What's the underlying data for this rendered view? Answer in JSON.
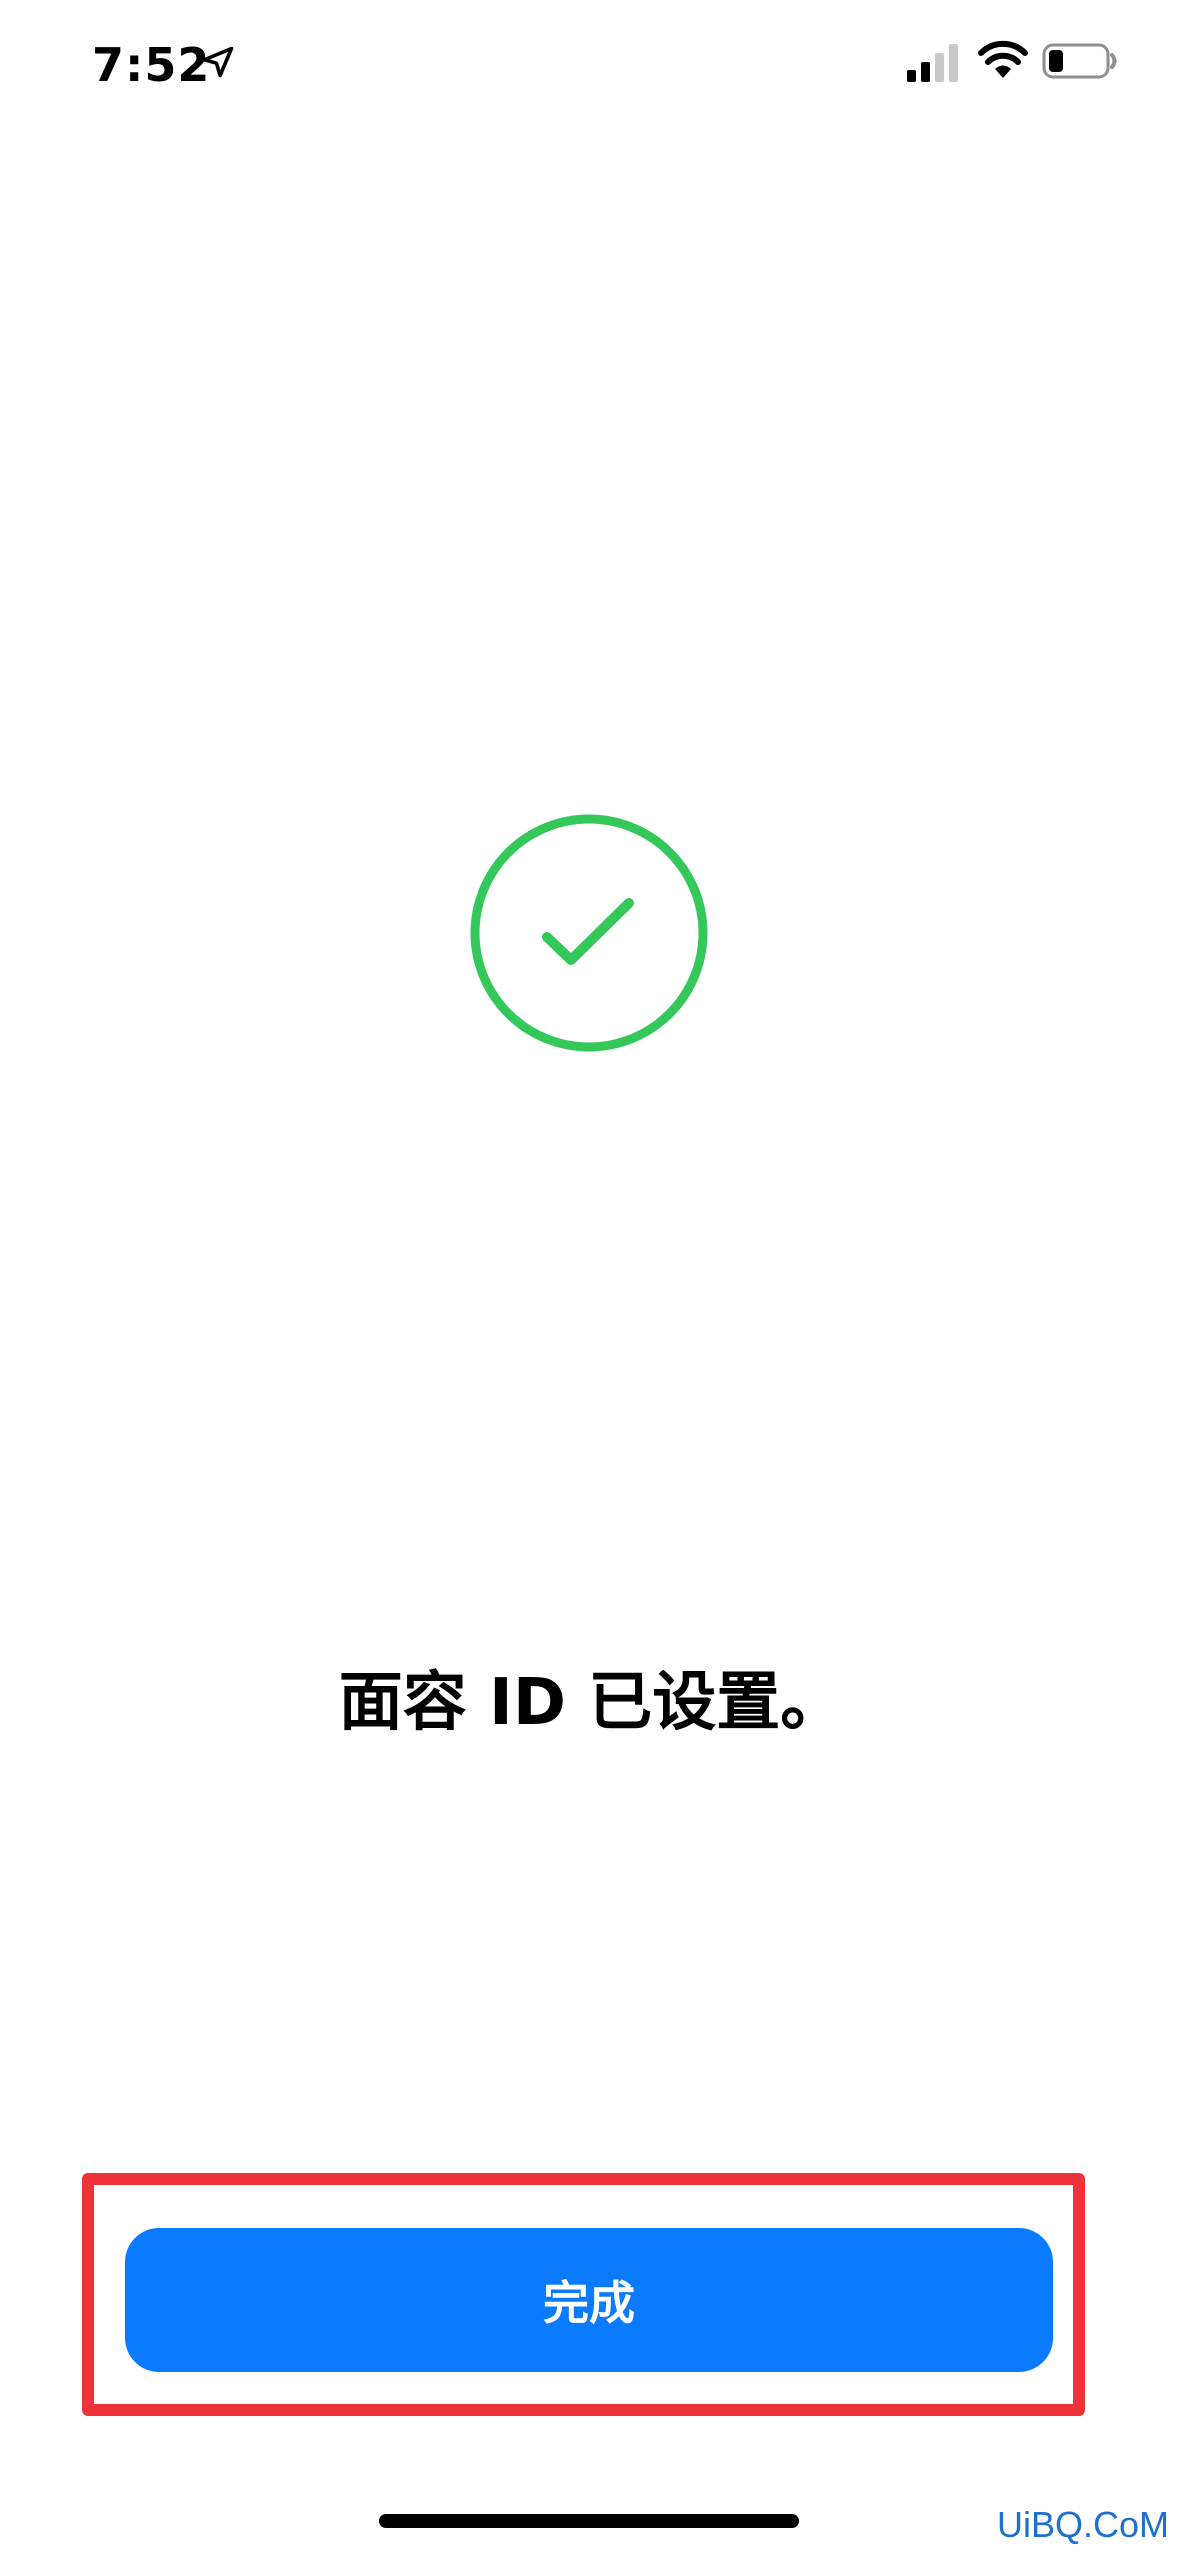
{
  "status_bar": {
    "time": "7:52",
    "location_icon": "location-arrow-icon",
    "signal_icon": "cellular-signal-icon",
    "wifi_icon": "wifi-icon",
    "battery_icon": "battery-low-icon"
  },
  "main": {
    "success_icon": "checkmark-circle-icon",
    "title": "面容 ID 已设置。"
  },
  "actions": {
    "done_label": "完成"
  },
  "watermark": {
    "text": "UiBQ.CoM"
  },
  "colors": {
    "accent": "#0A7AFF",
    "success": "#34C759",
    "highlight": "#EE3338",
    "watermark": "#1F6FD1"
  }
}
